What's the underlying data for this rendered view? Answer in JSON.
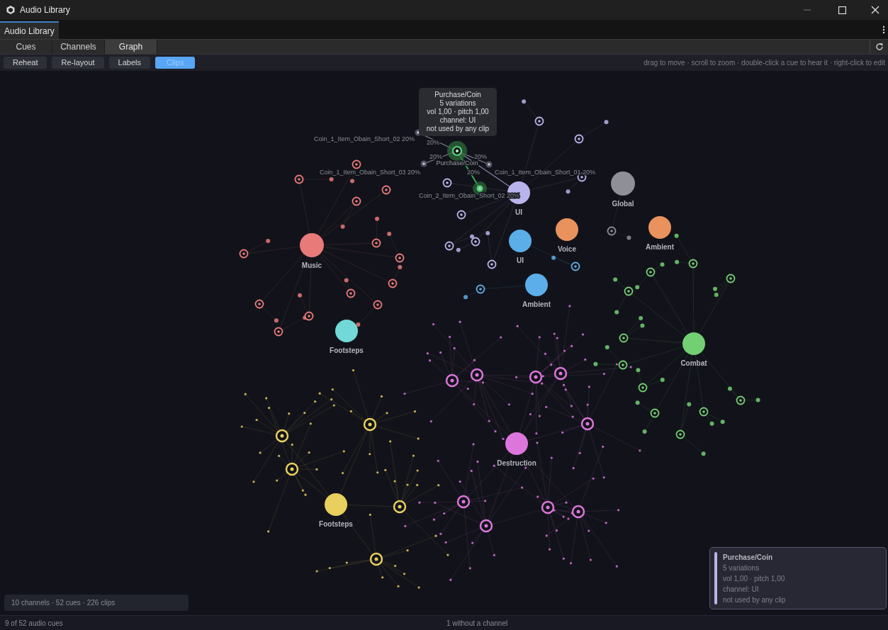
{
  "window": {
    "title": "Audio Library"
  },
  "doc_tab": {
    "label": "Audio Library",
    "selected": true
  },
  "tabs": [
    {
      "label": "Cues",
      "selected": false
    },
    {
      "label": "Channels",
      "selected": false
    },
    {
      "label": "Graph",
      "selected": true
    }
  ],
  "toolbar": {
    "buttons": [
      {
        "label": "Reheat",
        "selected": false
      },
      {
        "label": "Re-layout",
        "selected": false
      },
      {
        "label": "Labels",
        "selected": false
      },
      {
        "label": "Clips",
        "selected": true
      }
    ],
    "hint": "drag to move · scroll to zoom · double-click a cue to hear it · right-click to edit"
  },
  "graph": {
    "channels": [
      {
        "label": "Music",
        "color": "#e97a7a"
      },
      {
        "label": "UI",
        "color": "#b9b4ec"
      },
      {
        "label": "Global",
        "color": "#8f8f98"
      },
      {
        "label": "Voice",
        "color": "#e9925e"
      },
      {
        "label": "Ambient",
        "color": "#e9925e"
      },
      {
        "label": "UI",
        "color": "#5caee8"
      },
      {
        "label": "Ambient",
        "color": "#5caee8"
      },
      {
        "label": "Footsteps",
        "color": "#72d8d8"
      },
      {
        "label": "Combat",
        "color": "#72d072"
      },
      {
        "label": "Destruction",
        "color": "#dc76dc"
      },
      {
        "label": "Footsteps",
        "color": "#e9cf5e"
      }
    ],
    "selected_cue": {
      "label": "Purchase/Coin",
      "clips": [
        {
          "label": "Coin_1_Item_Obain_Short_02  20%",
          "share": "20%"
        },
        {
          "label": "Coin_1_Item_Obain_Short_03  20%",
          "share": "20%"
        },
        {
          "label": "Coin_1_Item_Obain_Short_01  20%",
          "share": "20%"
        },
        {
          "label": "Coin_2_Item_Obain_Short_02  20%",
          "share": "20%"
        }
      ]
    },
    "tooltip": {
      "lines": [
        "Purchase/Coin",
        "5 variations",
        "vol 1,00 · pitch 1,00",
        "channel: UI",
        "not used by any clip"
      ]
    }
  },
  "summary": "10 channels · 52 cues · 226 clips",
  "info_panel": {
    "title": "Purchase/Coin",
    "color": "#b9b4ec",
    "lines": [
      "5 variations",
      "vol 1,00 · pitch 1,00",
      "channel: UI",
      "not used by any clip"
    ]
  },
  "status_bar": {
    "left": "9 of 52 audio cues",
    "center": "1 without a channel"
  }
}
